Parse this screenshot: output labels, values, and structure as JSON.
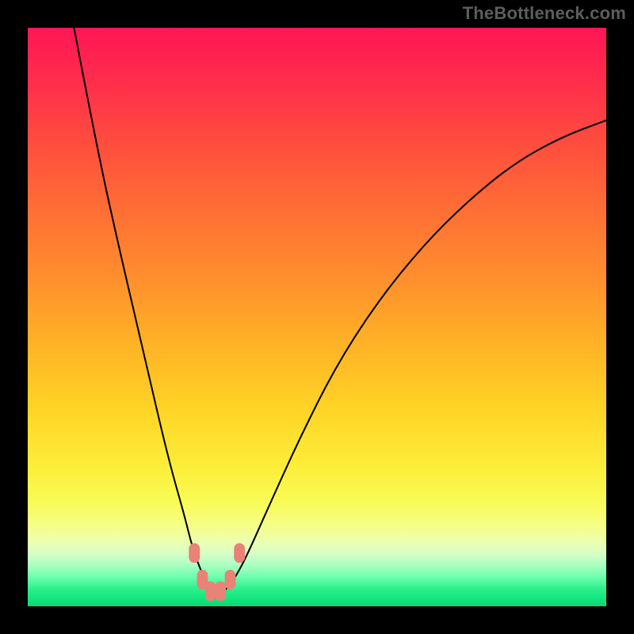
{
  "watermark": {
    "text": "TheBottleneck.com"
  },
  "chart_data": {
    "type": "line",
    "title": "",
    "xlabel": "",
    "ylabel": "",
    "xlim": [
      0,
      100
    ],
    "ylim": [
      0,
      100
    ],
    "grid": false,
    "legend": false,
    "series": [
      {
        "name": "bottleneck-curve",
        "x": [
          8,
          12,
          16,
          20,
          23,
          25,
          27,
          28.5,
          30,
          31,
          32,
          32.8,
          33.6,
          34.6,
          36,
          38,
          42,
          47,
          53,
          60,
          68,
          76,
          84,
          92,
          100
        ],
        "y": [
          100,
          79,
          61,
          44,
          31,
          23,
          16,
          10,
          6,
          3.8,
          2.8,
          2.4,
          2.5,
          3.2,
          5.2,
          9,
          18,
          29,
          41,
          52,
          62,
          70,
          76.5,
          81,
          84
        ]
      }
    ],
    "markers": [
      {
        "x": 28.8,
        "y": 9.2
      },
      {
        "x": 30.2,
        "y": 4.6
      },
      {
        "x": 31.6,
        "y": 2.6
      },
      {
        "x": 33.3,
        "y": 2.6
      },
      {
        "x": 35.0,
        "y": 4.6
      },
      {
        "x": 36.6,
        "y": 9.2
      }
    ],
    "gradient_background": {
      "type": "vertical",
      "stops": [
        {
          "pos": 0,
          "color": "#ff1656"
        },
        {
          "pos": 50,
          "color": "#ffb326"
        },
        {
          "pos": 82,
          "color": "#f8fb56"
        },
        {
          "pos": 100,
          "color": "#0cd873"
        }
      ]
    }
  }
}
